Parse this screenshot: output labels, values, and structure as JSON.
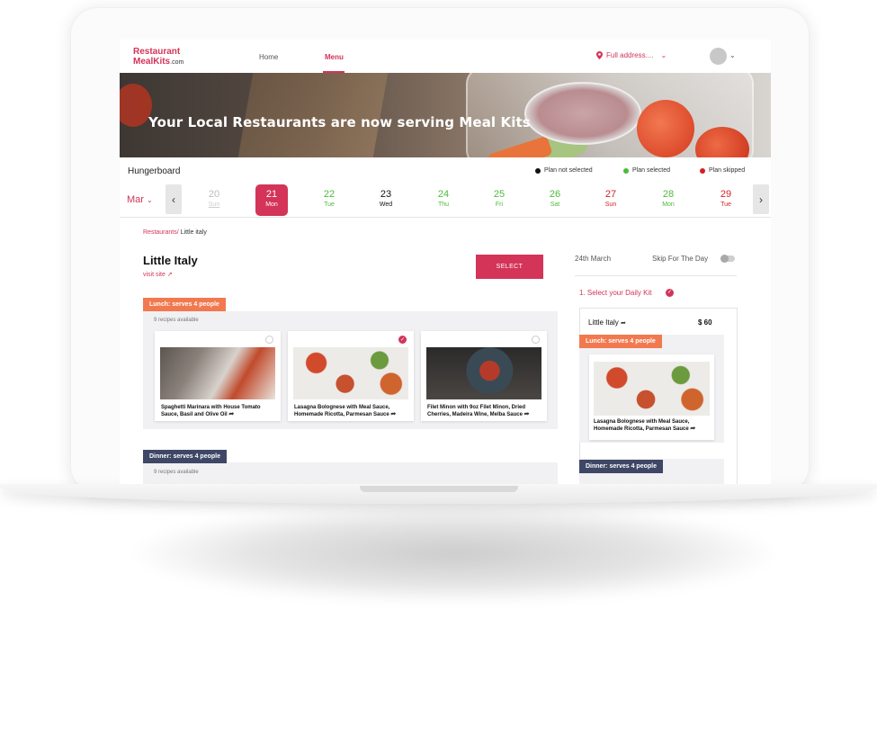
{
  "logo": {
    "line1": "Restaurant",
    "line2": "MealKits",
    "suffix": ".com"
  },
  "nav": {
    "home": "Home",
    "menu": "Menu"
  },
  "address": {
    "label": "Full address...."
  },
  "hero": {
    "title": "Your Local Restaurants are now serving Meal Kits"
  },
  "hungerboard": {
    "label": "Hungerboard",
    "month": "Mar"
  },
  "legend": [
    {
      "label": "Plan not selected",
      "color": "#111111"
    },
    {
      "label": "Plan selected",
      "color": "#4cbb3a"
    },
    {
      "label": "Plan skipped",
      "color": "#d61f26"
    }
  ],
  "days": [
    {
      "num": "20",
      "name": "Sun",
      "state": "past"
    },
    {
      "num": "21",
      "name": "Mon",
      "state": "active"
    },
    {
      "num": "22",
      "name": "Tue",
      "state": "selected"
    },
    {
      "num": "23",
      "name": "Wed",
      "state": "not-selected"
    },
    {
      "num": "24",
      "name": "Thu",
      "state": "selected"
    },
    {
      "num": "25",
      "name": "Fri",
      "state": "selected"
    },
    {
      "num": "26",
      "name": "Sat",
      "state": "selected"
    },
    {
      "num": "27",
      "name": "Sun",
      "state": "skipped"
    },
    {
      "num": "28",
      "name": "Mon",
      "state": "selected"
    },
    {
      "num": "29",
      "name": "Tue",
      "state": "skipped"
    }
  ],
  "breadcrumb": {
    "root": "Restaurants/",
    "current": "Little italy"
  },
  "restaurant": {
    "name": "Little Italy",
    "visit": "visit site"
  },
  "select_label": "SELECT",
  "lunch": {
    "tag": "Lunch: serves 4 people",
    "available": "9 recipes available",
    "recipes": [
      {
        "title": "Spaghetti Marinara with House Tomato Sauce, Basil and Olive Oil",
        "checked": false
      },
      {
        "title": "Lasagna Bolognese with Meal Sauce, Homemade Ricotta, Parmesan Sauce",
        "checked": true
      },
      {
        "title": "Filet Minon with 9oz Filet Minon, Dried Cherries, Madeira Wine, Melba Sauce",
        "checked": false
      }
    ]
  },
  "dinner": {
    "tag": "Dinner: serves 4 people",
    "available": "9 recipes available"
  },
  "right": {
    "date": "24th March",
    "skip": "Skip For The Day",
    "step": "1. Select your Daily Kit",
    "kit_name": "Little Italy",
    "price": "$ 60",
    "lunch_tag": "Lunch: serves 4 people",
    "lunch_recipe": "Lasagna Bolognese with Meal Sauce, Homemade Ricotta, Parmesan Sauce",
    "dinner_tag": "Dinner: serves 4 people"
  },
  "colors": {
    "brand": "#d33458",
    "lunch": "#f2794f",
    "dinner": "#3e4766",
    "selected": "#4cbb3a",
    "skipped": "#d61f26"
  }
}
